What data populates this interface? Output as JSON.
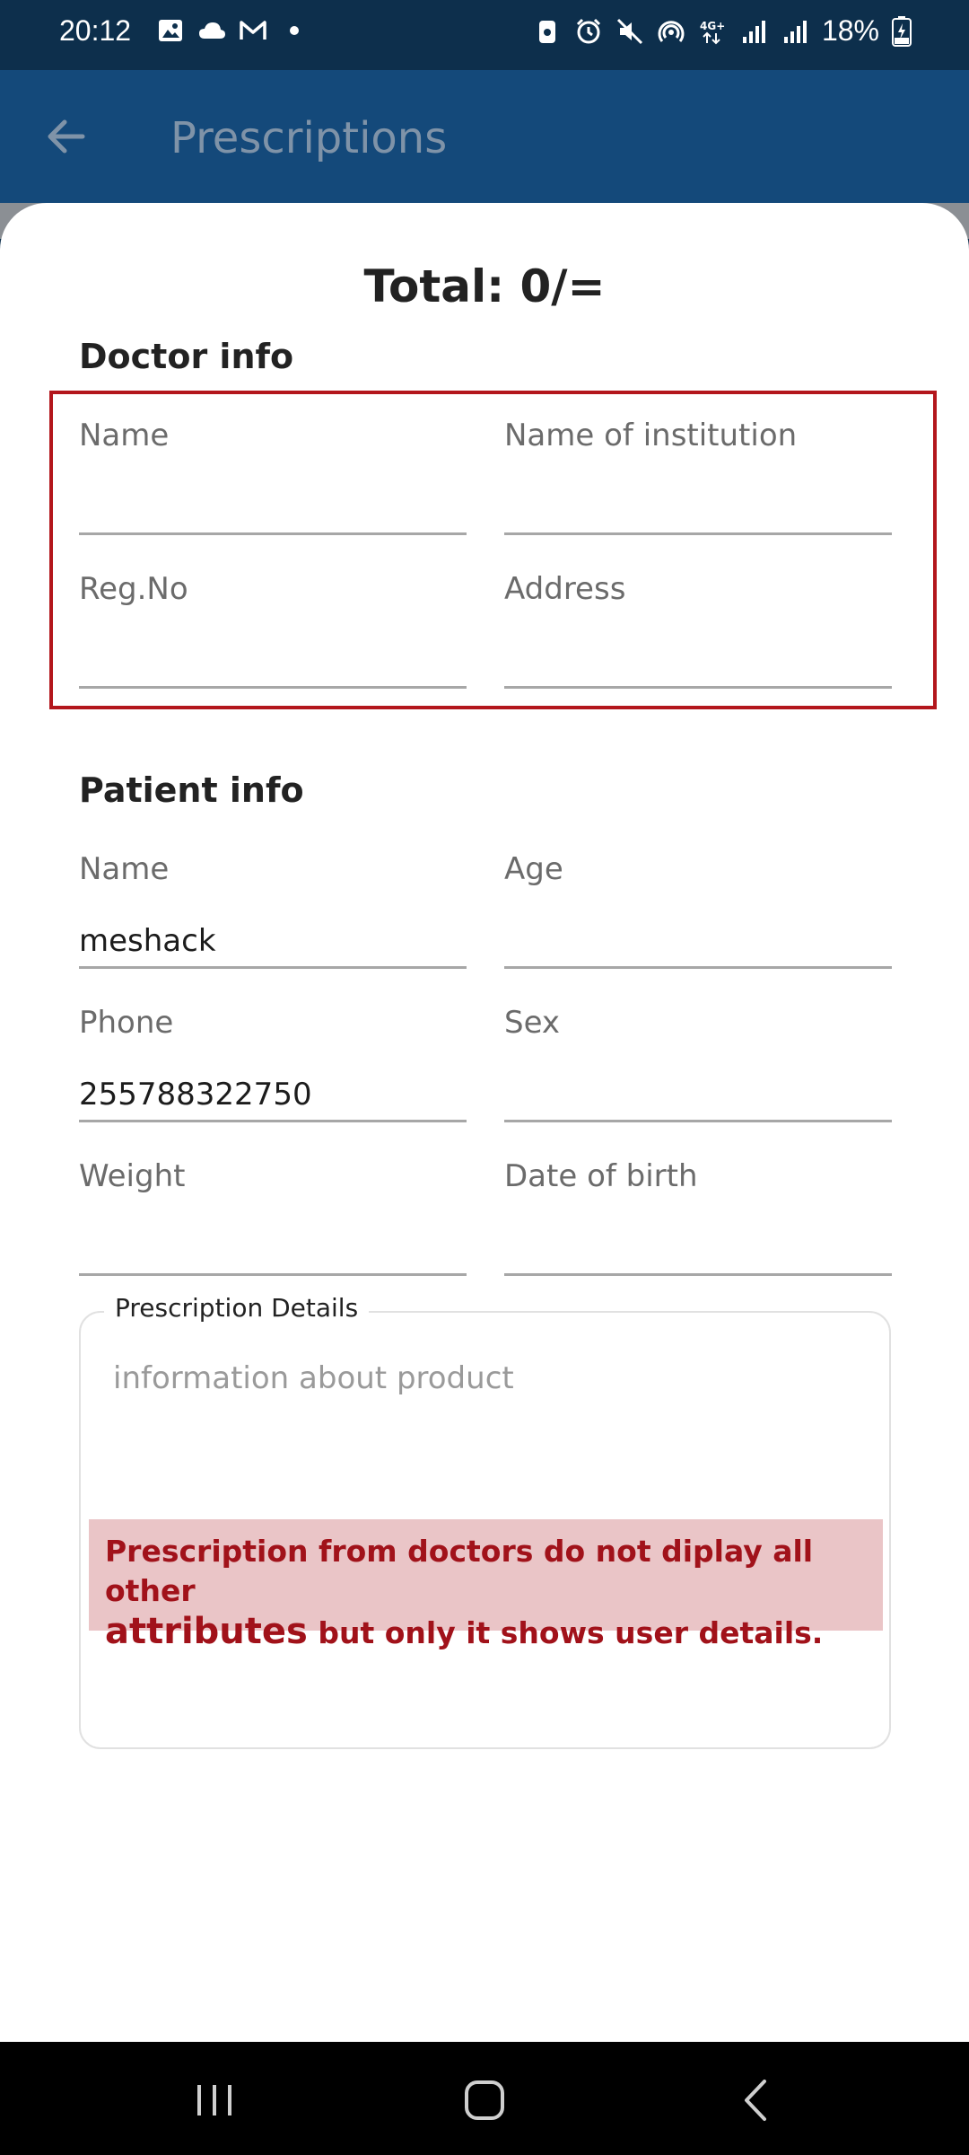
{
  "status_bar": {
    "time": "20:12",
    "battery": "18%",
    "network": "4G+",
    "left_icons": [
      "image-icon",
      "cloud-icon",
      "gmail-icon",
      "dot-icon"
    ],
    "right_icons": [
      "nfc-icon",
      "alarm-icon",
      "mute-icon",
      "hotspot-icon",
      "network-4g-icon",
      "signal-icon",
      "signal-icon",
      "battery-icon"
    ]
  },
  "app_bar": {
    "title": "Prescriptions",
    "back_icon": "arrow-left-icon"
  },
  "total_label": "Total: 0/=",
  "doctor_info": {
    "title": "Doctor info",
    "fields": {
      "name": {
        "label": "Name",
        "value": ""
      },
      "institution": {
        "label": "Name of institution",
        "value": ""
      },
      "reg_no": {
        "label": "Reg.No",
        "value": ""
      },
      "address": {
        "label": "Address",
        "value": ""
      }
    }
  },
  "patient_info": {
    "title": "Patient info",
    "fields": {
      "name": {
        "label": "Name",
        "value": "meshack"
      },
      "age": {
        "label": "Age",
        "value": ""
      },
      "phone": {
        "label": "Phone",
        "value": "255788322750"
      },
      "sex": {
        "label": "Sex",
        "value": ""
      },
      "weight": {
        "label": "Weight",
        "value": ""
      },
      "dob": {
        "label": "Date of birth",
        "value": ""
      }
    }
  },
  "prescription_details": {
    "legend": "Prescription Details",
    "placeholder": "information about product"
  },
  "annotation": {
    "line1": "Prescription from doctors do not diplay all other",
    "big_word": "attributes",
    "line2_rest": " but only it shows user details."
  },
  "colors": {
    "status_bar_bg": "#0d2f4c",
    "app_bar_bg": "#14497a",
    "highlight_border": "#b3161c",
    "annotation_bg": "#eac5c7",
    "annotation_text": "#a1121a"
  }
}
